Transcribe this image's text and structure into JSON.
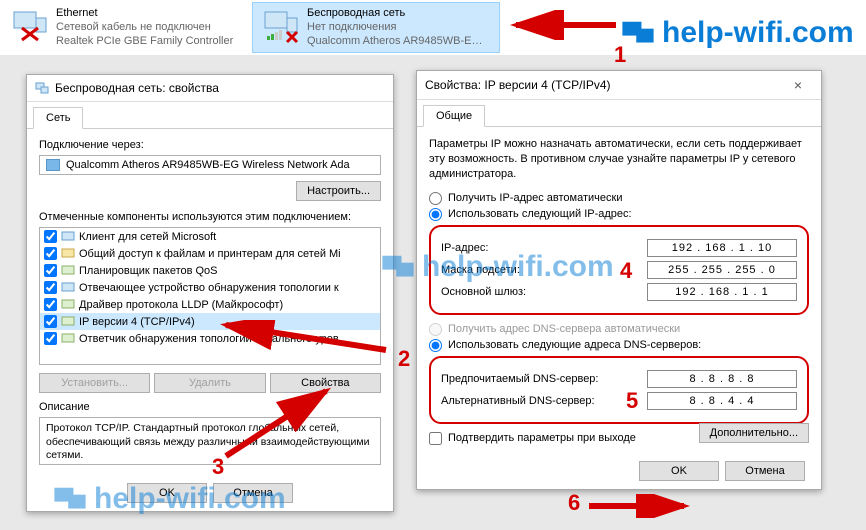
{
  "adapters": [
    {
      "name": "Ethernet",
      "sub1": "Сетевой кабель не подключен",
      "sub2": "Realtek PCIe GBE Family Controller"
    },
    {
      "name": "Беспроводная сеть",
      "sub1": "Нет подключения",
      "sub2": "Qualcomm Atheros AR9485WB-E…"
    }
  ],
  "site_brand": "help-wifi.com",
  "props": {
    "title": "Беспроводная сеть: свойства",
    "tab": "Сеть",
    "connect_label": "Подключение через:",
    "adapter_name": "Qualcomm Atheros AR9485WB-EG Wireless Network Ada",
    "configure_btn": "Настроить...",
    "components_label": "Отмеченные компоненты используются этим подключением:",
    "components": [
      "Клиент для сетей Microsoft",
      "Общий доступ к файлам и принтерам для сетей Mi",
      "Планировщик пакетов QoS",
      "Отвечающее устройство обнаружения топологии к",
      "Драйвер протокола LLDP (Майкрософт)",
      "IP версии 4 (TCP/IPv4)",
      "Ответчик обнаружения топологии канального уров"
    ],
    "btn_install": "Установить...",
    "btn_remove": "Удалить",
    "btn_props": "Свойства",
    "desc_label": "Описание",
    "desc_text": "Протокол TCP/IP. Стандартный протокол глобальных сетей, обеспечивающий связь между различными взаимодействующими сетями.",
    "ok": "OK",
    "cancel": "Отмена"
  },
  "ipv4": {
    "title": "Свойства: IP версии 4 (TCP/IPv4)",
    "tab": "Общие",
    "para": "Параметры IP можно назначать автоматически, если сеть поддерживает эту возможность. В противном случае узнайте параметры IP у сетевого администратора.",
    "r_auto_ip": "Получить IP-адрес автоматически",
    "r_man_ip": "Использовать следующий IP-адрес:",
    "ip_label": "IP-адрес:",
    "ip_val": "192 . 168 .  1  . 10",
    "mask_label": "Маска подсети:",
    "mask_val": "255 . 255 . 255 .  0",
    "gw_label": "Основной шлюз:",
    "gw_val": "192 . 168 .  1  .  1",
    "r_auto_dns": "Получить адрес DNS-сервера автоматически",
    "r_man_dns": "Использовать следующие адреса DNS-серверов:",
    "dns1_label": "Предпочитаемый DNS-сервер:",
    "dns1_val": "8  .  8  .  8  .  8",
    "dns2_label": "Альтернативный DNS-сервер:",
    "dns2_val": "8  .  8  .  4  .  4",
    "validate_chk": "Подтвердить параметры при выходе",
    "advanced_btn": "Дополнительно...",
    "ok": "OK",
    "cancel": "Отмена"
  },
  "nums": {
    "n1": "1",
    "n2": "2",
    "n3": "3",
    "n4": "4",
    "n5": "5",
    "n6": "6"
  }
}
